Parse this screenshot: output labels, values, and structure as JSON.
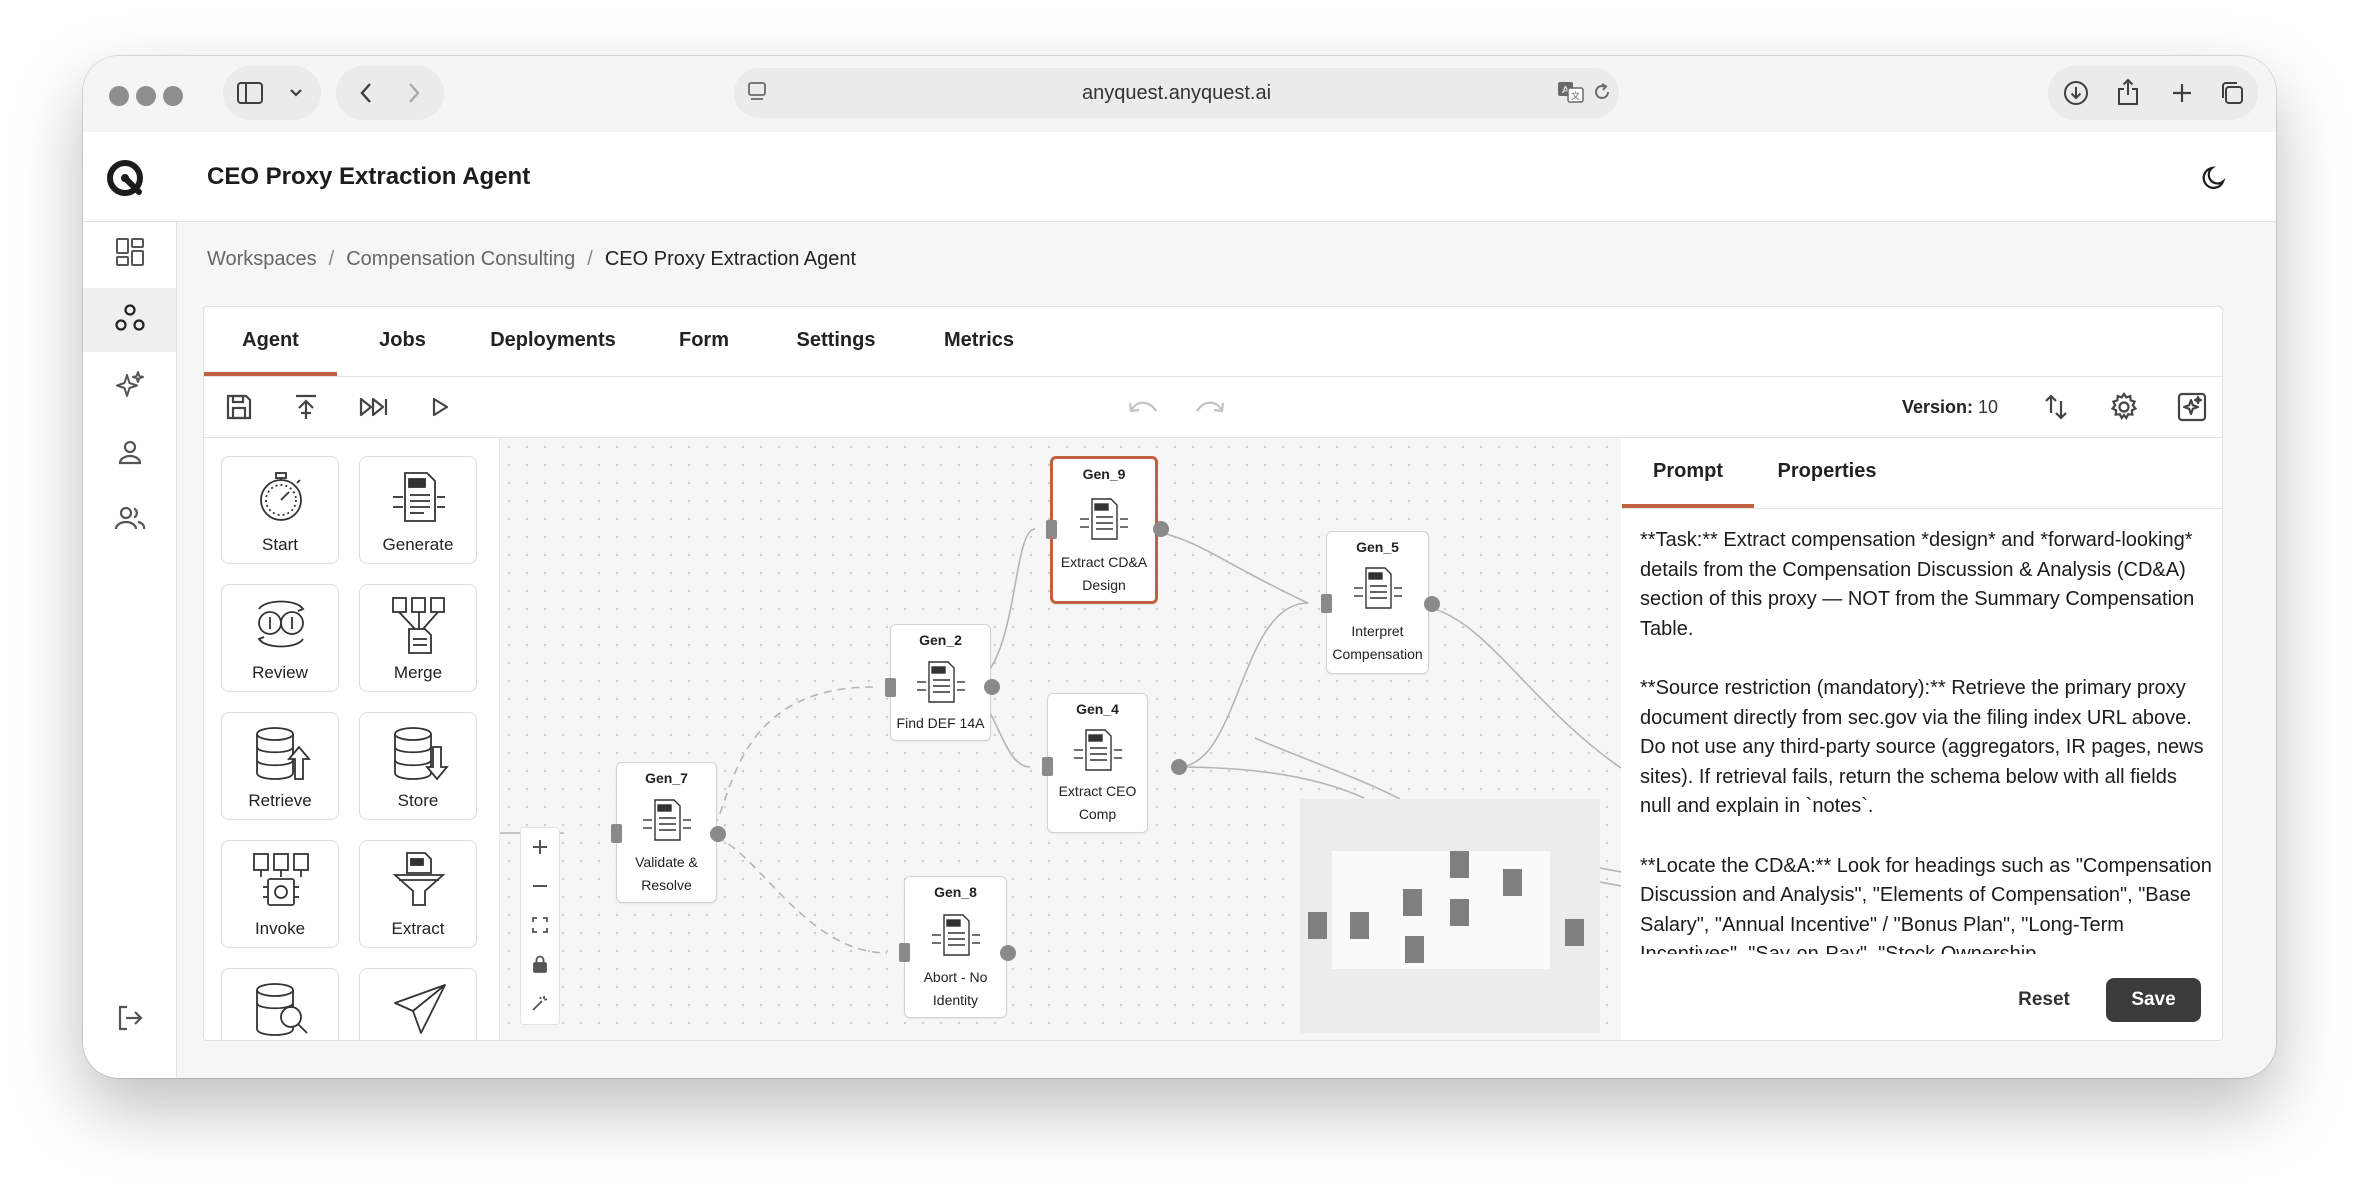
{
  "browser": {
    "url": "anyquest.anyquest.ai"
  },
  "app": {
    "title": "CEO Proxy Extraction Agent"
  },
  "breadcrumb": {
    "items": [
      "Workspaces",
      "Compensation Consulting",
      "CEO Proxy Extraction Agent"
    ],
    "separator": "/"
  },
  "tabs": [
    "Agent",
    "Jobs",
    "Deployments",
    "Form",
    "Settings",
    "Metrics"
  ],
  "active_tab": "Agent",
  "toolbar": {
    "version_label": "Version:",
    "version_value": "10"
  },
  "palette": {
    "items": [
      "Start",
      "Generate",
      "Review",
      "Merge",
      "Retrieve",
      "Store",
      "Invoke",
      "Extract",
      "",
      ""
    ]
  },
  "nodes": [
    {
      "id": "Gen_9",
      "label_lines": [
        "Extract CD&A",
        "Design"
      ],
      "selected": true
    },
    {
      "id": "Gen_5",
      "label_lines": [
        "Interpret",
        "Compensation"
      ],
      "selected": false
    },
    {
      "id": "Gen_2",
      "label_lines": [
        "Find DEF 14A"
      ],
      "selected": false
    },
    {
      "id": "Gen_4",
      "label_lines": [
        "Extract CEO",
        "Comp"
      ],
      "selected": false
    },
    {
      "id": "Gen_7",
      "label_lines": [
        "Validate &",
        "Resolve"
      ],
      "selected": false
    },
    {
      "id": "Gen_8",
      "label_lines": [
        "Abort - No",
        "Identity"
      ],
      "selected": false
    }
  ],
  "right_panel": {
    "tabs": [
      "Prompt",
      "Properties"
    ],
    "active_tab": "Prompt",
    "prompt_text": "**Task:** Extract compensation *design* and *forward-looking* details from the Compensation Discussion & Analysis (CD&A) section of this proxy — NOT from the Summary Compensation Table.\n\n**Source restriction (mandatory):** Retrieve the primary proxy document directly from sec.gov via the filing index URL above. Do not use any third-party source (aggregators, IR pages, news sites). If retrieval fails, return the schema below with all fields null and explain in `notes`.\n\n**Locate the CD&A:** Look for headings such as \"Compensation Discussion and Analysis\", \"Elements of Compensation\", \"Base Salary\", \"Annual Incentive\" / \"Bonus Plan\", \"Long-Term Incentives\", \"Say-on-Pay\", \"Stock Ownership",
    "reset_label": "Reset",
    "save_label": "Save"
  },
  "colors": {
    "accent": "#c0613f",
    "save_button": "#3b3b3b"
  }
}
